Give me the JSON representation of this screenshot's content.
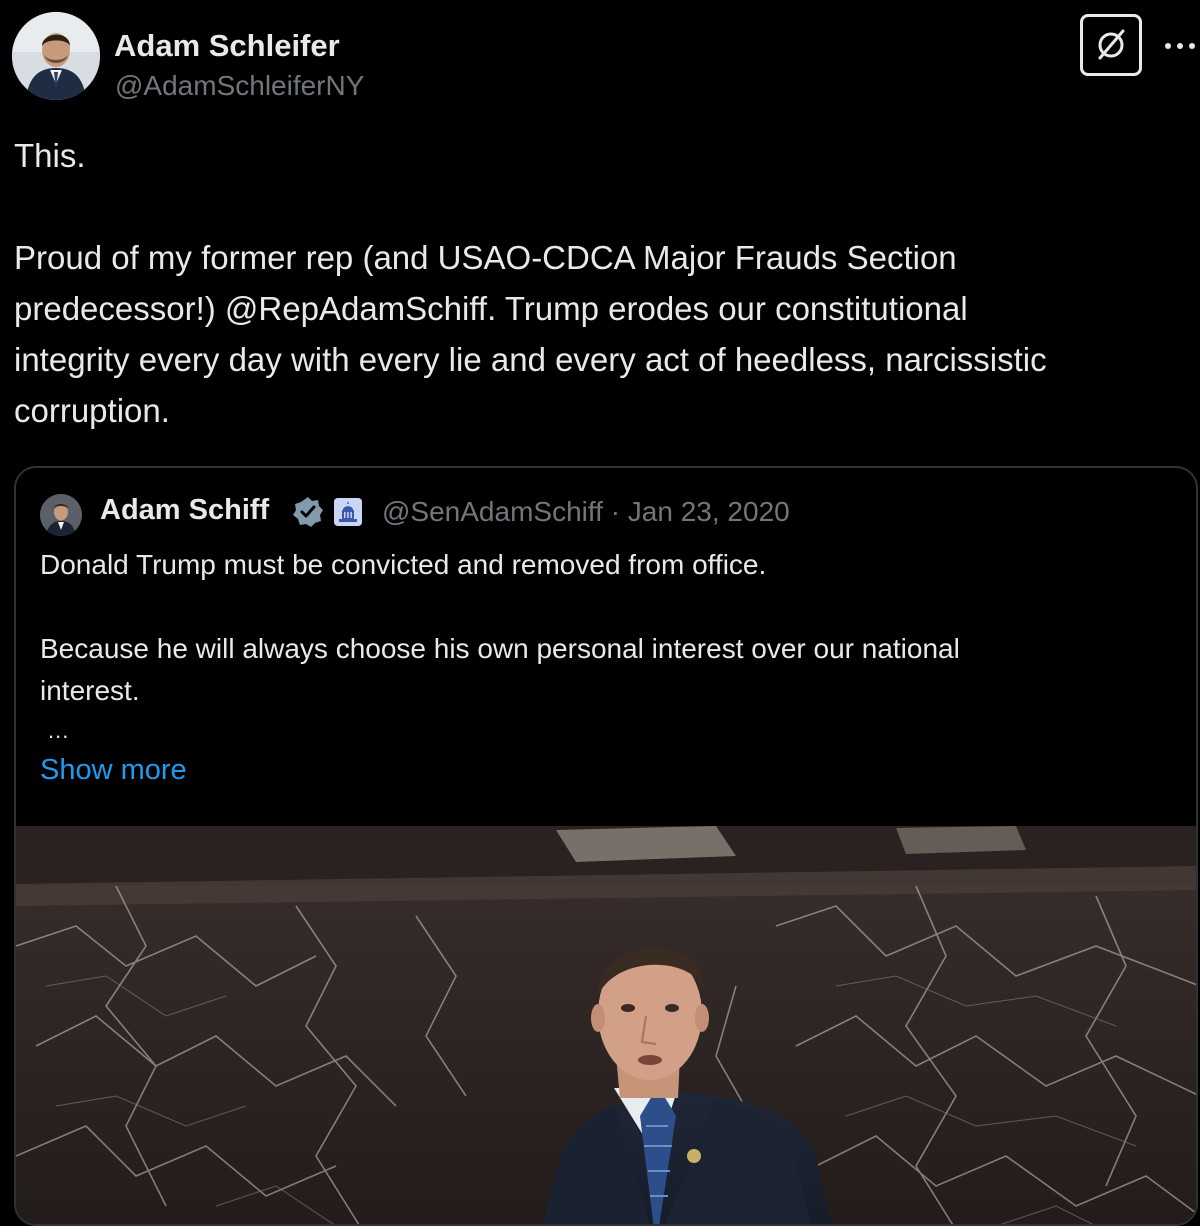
{
  "post": {
    "author_name": "Adam Schleifer",
    "author_handle": "@AdamSchleiferNY",
    "avatar_icon": "user-avatar",
    "grok_icon": "grok-icon",
    "more_icon": "more-options-icon",
    "more_label": "···",
    "lines": [
      "This.",
      "",
      "Proud of my former rep (and USAO-CDCA Major Frauds Section",
      "predecessor!) @RepAdamSchiff.  Trump erodes our constitutional",
      "integrity every day with every lie and every act of heedless, narcissistic",
      "corruption."
    ]
  },
  "quote": {
    "author_name": "Adam Schiff",
    "verified_icon": "verified-badge-icon",
    "affiliate_icon": "capitol-badge-icon",
    "handle_date": "@SenAdamSchiff · Jan 23, 2020",
    "lines": [
      "Donald Trump must be convicted and removed from office.",
      "",
      "Because he will always choose his own personal interest over our national",
      "interest."
    ],
    "ellipsis": "...",
    "show_more": "Show more",
    "media_description_icon": "video-thumbnail"
  },
  "colors": {
    "background": "#000000",
    "text": "#e7e9ea",
    "secondary": "#71767b",
    "link": "#1d9bf0",
    "border": "#2f3336"
  }
}
